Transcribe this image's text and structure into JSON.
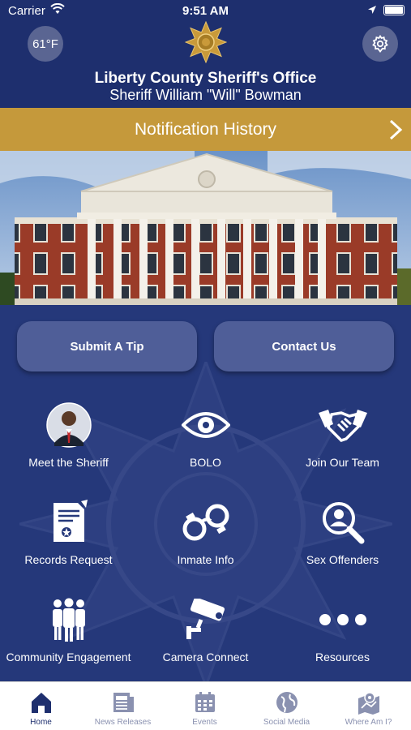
{
  "status_bar": {
    "carrier": "Carrier",
    "time": "9:51 AM"
  },
  "header": {
    "temperature": "61°F",
    "office_title": "Liberty County Sheriff's Office",
    "sheriff_name": "Sheriff William \"Will\" Bowman"
  },
  "notification_bar": {
    "label": "Notification History"
  },
  "actions": {
    "submit_tip": "Submit A Tip",
    "contact_us": "Contact Us"
  },
  "tiles": [
    {
      "label": "Meet the Sheriff",
      "icon": "sheriff-photo"
    },
    {
      "label": "BOLO",
      "icon": "eye-icon"
    },
    {
      "label": "Join Our Team",
      "icon": "handshake-icon"
    },
    {
      "label": "Records Request",
      "icon": "document-icon"
    },
    {
      "label": "Inmate Info",
      "icon": "handcuffs-icon"
    },
    {
      "label": "Sex Offenders",
      "icon": "person-search-icon"
    },
    {
      "label": "Community Engagement",
      "icon": "people-icon"
    },
    {
      "label": "Camera Connect",
      "icon": "security-camera-icon"
    },
    {
      "label": "Resources",
      "icon": "more-dots-icon"
    }
  ],
  "tabs": [
    {
      "label": "Home",
      "icon": "home-icon",
      "active": true
    },
    {
      "label": "News Releases",
      "icon": "newspaper-icon",
      "active": false
    },
    {
      "label": "Events",
      "icon": "calendar-icon",
      "active": false
    },
    {
      "label": "Social Media",
      "icon": "globe-icon",
      "active": false
    },
    {
      "label": "Where Am I?",
      "icon": "map-icon",
      "active": false
    }
  ],
  "colors": {
    "navy": "#1e2f6e",
    "main_blue": "#25387a",
    "gold": "#c5993b",
    "button_blue": "#4f5e98"
  }
}
